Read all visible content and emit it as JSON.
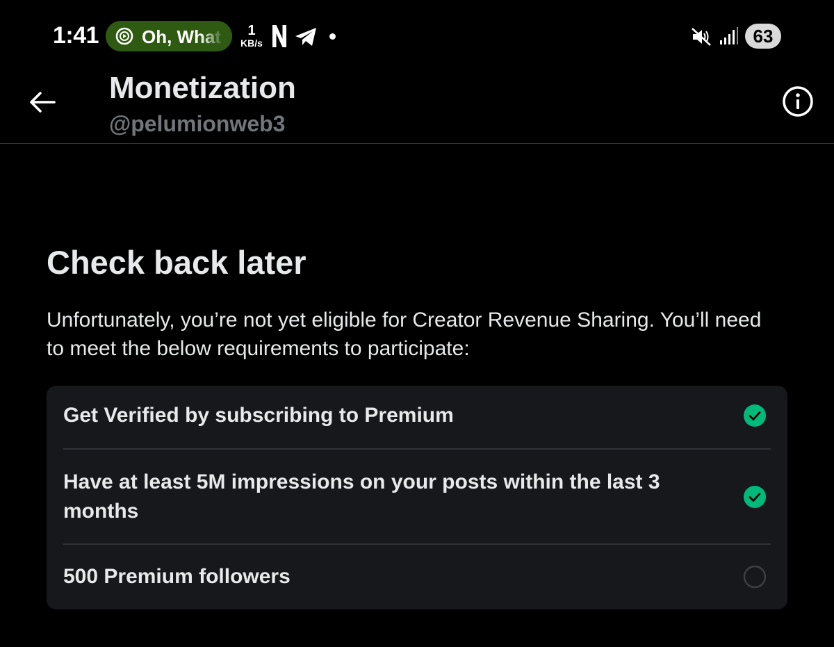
{
  "status_bar": {
    "time": "1:41",
    "media_text": "Oh, What",
    "net_speed_value": "1",
    "net_speed_unit": "KB/s",
    "battery": "63",
    "icons": [
      "play-circle-icon",
      "netflix-icon",
      "telegram-icon",
      "notification-dot-icon",
      "mute-icon",
      "signal-icon"
    ]
  },
  "header": {
    "title": "Monetization",
    "handle": "@pelumionweb3",
    "icons": [
      "back-arrow-icon",
      "info-icon"
    ]
  },
  "content": {
    "heading": "Check back later",
    "description": "Unfortunately, you’re not yet eligible for Creator Revenue Sharing. You’ll need to meet the below requirements to participate:"
  },
  "requirements": [
    {
      "label": "Get Verified by subscribing to Premium",
      "met": true
    },
    {
      "label": "Have at least 5M impressions on your posts within the last 3 months",
      "met": true
    },
    {
      "label": "500 Premium followers",
      "met": false
    }
  ],
  "colors": {
    "background": "#000000",
    "card": "#16181c",
    "text_primary": "#e7e9ea",
    "text_secondary": "#71767b",
    "check_green": "#00ba7c",
    "media_pill": "#2f5a12",
    "divider": "#2f3336"
  }
}
